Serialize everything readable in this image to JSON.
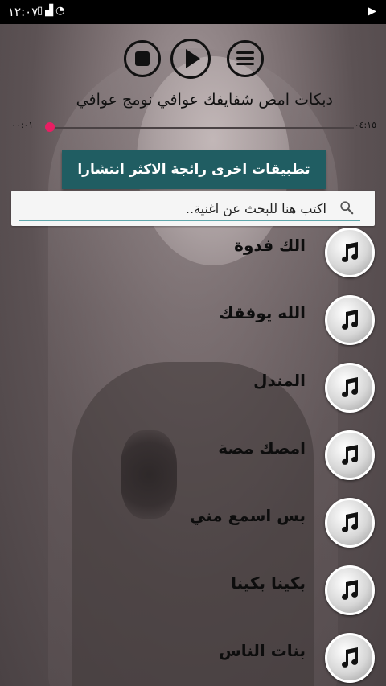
{
  "status_bar": {
    "time": "١٢:٠٧",
    "icons": [
      "sim-icon",
      "signal-icon",
      "wifi-icon"
    ],
    "right_icon": "play-store-icon"
  },
  "player": {
    "controls": [
      "stop-icon",
      "play-icon",
      "menu-icon"
    ],
    "track_title": "دبكات امص شفايفك عوافي نومج عوافي",
    "elapsed": "٠٠:٠١",
    "duration": "٠٤:١٥",
    "progress": 0.0,
    "accent_color": "#e91e63"
  },
  "promo_button": {
    "label": "تطبيقات اخرى رائجة الاكثر انتشارا",
    "color": "#205d62"
  },
  "search": {
    "placeholder": "اكتب هنا للبحث عن اغنية..",
    "value": ""
  },
  "songs": [
    {
      "name": "الك فدوة"
    },
    {
      "name": "الله يوفقك"
    },
    {
      "name": "المندل"
    },
    {
      "name": "امصك مصة"
    },
    {
      "name": "بس اسمع مني"
    },
    {
      "name": "بكينا بكينا"
    },
    {
      "name": "بنات الناس"
    }
  ]
}
